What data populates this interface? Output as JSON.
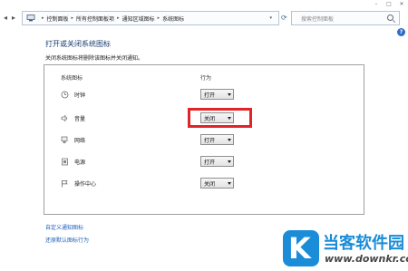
{
  "window": {
    "minimize_glyph": "–",
    "maximize_glyph": "□",
    "close_glyph": "✕"
  },
  "address": {
    "crumbs": [
      "控制面板",
      "所有控制面板项",
      "通知区域图标",
      "系统图标"
    ],
    "search_placeholder": "搜索控制面板"
  },
  "page": {
    "title": "打开或关闭系统图标",
    "description": "关闭系统图标将删除该图标并关闭通知。"
  },
  "table": {
    "col_icon": "系统图标",
    "col_behavior": "行为",
    "rows": [
      {
        "label": "时钟",
        "value": "打开",
        "icon": "clock-icon"
      },
      {
        "label": "音量",
        "value": "关闭",
        "icon": "volume-icon"
      },
      {
        "label": "网络",
        "value": "打开",
        "icon": "network-icon"
      },
      {
        "label": "电源",
        "value": "打开",
        "icon": "power-icon"
      },
      {
        "label": "操作中心",
        "value": "关闭",
        "icon": "flag-icon"
      }
    ]
  },
  "links": {
    "customize": "自定义通知图标",
    "restore": "还原默认图标行为"
  },
  "help": "?",
  "watermark": {
    "title": "当客软件园",
    "url": "www.downkr.com",
    "logo_letter": "K"
  },
  "colors": {
    "highlight": "#e0242a",
    "link": "#1c5fb8",
    "title": "#1a3c6e",
    "brand": "#1a8cd8"
  }
}
